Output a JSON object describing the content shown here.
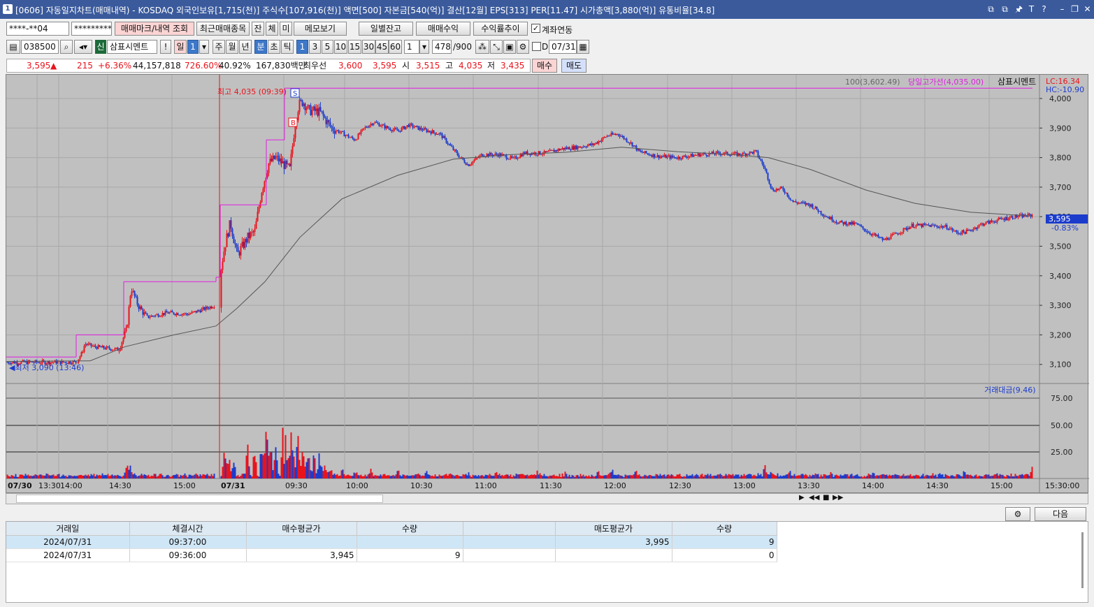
{
  "window": {
    "screen_no": "1",
    "title": "[0606] 자동일지차트(매매내역) - KOSDAQ 외국인보유[1,715(천)] 주식수[107,916(천)] 액면[500] 자본금[540(억)] 결산[12월] EPS[313] PER[11.47] 시가총액[3,880(억)] 유통비율[34.8]",
    "controls": [
      "⧉",
      "⧉",
      "🖈",
      "T",
      "?",
      "–",
      "❐",
      "✕"
    ]
  },
  "toolbar1": {
    "account": "****-**04",
    "password": "*********",
    "mark_query": "매매마크/내역 조회",
    "recent_items": "최근매매종목",
    "tab_jan": "잔",
    "tab_che": "체",
    "tab_mi": "미",
    "memo": "메모보기",
    "daily_balance": "일별잔고",
    "trade_profit": "매매수익",
    "return_trend": "수익률추이",
    "link_account": "계좌연동"
  },
  "toolbar2": {
    "code": "038500",
    "new_badge": "신",
    "name": "삼표시멘트",
    "excl": "!",
    "period_day": "일",
    "period_val": "1",
    "week": "주",
    "month": "월",
    "year": "년",
    "minute": "분",
    "second": "초",
    "tick": "틱",
    "intervals": [
      "1",
      "3",
      "5",
      "10",
      "15",
      "30",
      "45",
      "60"
    ],
    "interval_sel": "1",
    "count": "478",
    "total": "/900",
    "d_label": "D",
    "date": "07/31"
  },
  "quote": {
    "price": "3,595",
    "arrow": "▲",
    "change": "215",
    "change_pct": "+6.36%",
    "volume": "44,157,818",
    "vol_ratio": "726.60%",
    "turnover_pct": "40.92%",
    "amount": "167,830백만",
    "best_label": "최우선",
    "best_ask": "3,600",
    "best_bid": "3,595",
    "open_label": "시",
    "open": "3,515",
    "high_label": "고",
    "high": "4,035",
    "low_label": "저",
    "low": "3,435",
    "buy_btn": "매수",
    "sell_btn": "매도"
  },
  "chart": {
    "legend_ma": "100(3,602.49)",
    "legend_high_line": "당일고가선(4,035.00)",
    "legend_name": "삼표시멘트",
    "lc": "LC:16.34",
    "hc": "HC:-10.90",
    "high_annot": "최고 4,035 (09:39)",
    "low_annot": "◀최저 3,090 (13:46)",
    "current_price_tag": "3,595",
    "current_pct_tag": "-0.83%",
    "vol_legend": "거래대금(9.46)",
    "colors": {
      "up": "#e8141c",
      "down": "#1c3ccc",
      "ma": "#555555",
      "highline": "#e01ee0",
      "vline": "#e8141c"
    }
  },
  "chart_data": {
    "type": "candlestick",
    "y_ticks": [
      "4,000",
      "3,900",
      "3,800",
      "3,700",
      "3,600",
      "3,500",
      "3,400",
      "3,300",
      "3,200",
      "3,100"
    ],
    "vol_ticks": [
      "75.00",
      "50.00",
      "25.00"
    ],
    "x_labels": [
      "07/30",
      "13:30",
      "14:00",
      "14:30",
      "15:00",
      "07/31",
      "09:30",
      "10:00",
      "10:30",
      "11:00",
      "11:30",
      "12:00",
      "12:30",
      "13:00",
      "13:30",
      "14:00",
      "14:30",
      "15:00",
      "15:30:00"
    ],
    "price_path": [
      [
        0,
        3107
      ],
      [
        100,
        3108
      ],
      [
        108,
        3140
      ],
      [
        112,
        3170
      ],
      [
        125,
        3160
      ],
      [
        160,
        3150
      ],
      [
        172,
        3220
      ],
      [
        178,
        3360
      ],
      [
        188,
        3300
      ],
      [
        200,
        3260
      ],
      [
        230,
        3275
      ],
      [
        260,
        3270
      ],
      [
        298,
        3300
      ],
      [
        312,
        3500
      ],
      [
        320,
        3580
      ],
      [
        330,
        3470
      ],
      [
        345,
        3530
      ],
      [
        355,
        3550
      ],
      [
        365,
        3690
      ],
      [
        375,
        3780
      ],
      [
        385,
        3800
      ],
      [
        395,
        3780
      ],
      [
        405,
        3760
      ],
      [
        413,
        3920
      ],
      [
        418,
        3980
      ],
      [
        424,
        3990
      ],
      [
        432,
        3960
      ],
      [
        448,
        3955
      ],
      [
        465,
        3900
      ],
      [
        482,
        3880
      ],
      [
        498,
        3860
      ],
      [
        512,
        3900
      ],
      [
        525,
        3920
      ],
      [
        545,
        3900
      ],
      [
        560,
        3890
      ],
      [
        575,
        3910
      ],
      [
        595,
        3895
      ],
      [
        620,
        3880
      ],
      [
        645,
        3810
      ],
      [
        660,
        3775
      ],
      [
        680,
        3810
      ],
      [
        705,
        3810
      ],
      [
        725,
        3795
      ],
      [
        740,
        3815
      ],
      [
        770,
        3815
      ],
      [
        795,
        3830
      ],
      [
        815,
        3835
      ],
      [
        840,
        3845
      ],
      [
        860,
        3875
      ],
      [
        875,
        3880
      ],
      [
        895,
        3845
      ],
      [
        905,
        3820
      ],
      [
        930,
        3805
      ],
      [
        960,
        3800
      ],
      [
        990,
        3810
      ],
      [
        1020,
        3815
      ],
      [
        1050,
        3810
      ],
      [
        1072,
        3820
      ],
      [
        1085,
        3760
      ],
      [
        1095,
        3690
      ],
      [
        1110,
        3695
      ],
      [
        1125,
        3650
      ],
      [
        1150,
        3640
      ],
      [
        1170,
        3605
      ],
      [
        1190,
        3580
      ],
      [
        1215,
        3575
      ],
      [
        1235,
        3545
      ],
      [
        1255,
        3520
      ],
      [
        1275,
        3545
      ],
      [
        1295,
        3570
      ],
      [
        1320,
        3570
      ],
      [
        1345,
        3565
      ],
      [
        1360,
        3545
      ],
      [
        1375,
        3550
      ],
      [
        1395,
        3575
      ],
      [
        1420,
        3590
      ],
      [
        1440,
        3600
      ],
      [
        1468,
        3605
      ]
    ],
    "ma_path": [
      [
        0,
        3110
      ],
      [
        120,
        3112
      ],
      [
        170,
        3160
      ],
      [
        240,
        3200
      ],
      [
        300,
        3230
      ],
      [
        330,
        3290
      ],
      [
        370,
        3380
      ],
      [
        420,
        3530
      ],
      [
        480,
        3660
      ],
      [
        560,
        3740
      ],
      [
        640,
        3795
      ],
      [
        720,
        3810
      ],
      [
        800,
        3818
      ],
      [
        880,
        3835
      ],
      [
        960,
        3820
      ],
      [
        1040,
        3810
      ],
      [
        1090,
        3800
      ],
      [
        1150,
        3760
      ],
      [
        1230,
        3690
      ],
      [
        1300,
        3645
      ],
      [
        1380,
        3615
      ],
      [
        1468,
        3602
      ]
    ],
    "volume_peaks": [
      [
        172,
        12
      ],
      [
        178,
        9
      ],
      [
        312,
        22
      ],
      [
        318,
        14
      ],
      [
        325,
        18
      ],
      [
        345,
        25
      ],
      [
        355,
        31
      ],
      [
        365,
        40
      ],
      [
        372,
        46
      ],
      [
        378,
        30
      ],
      [
        385,
        22
      ],
      [
        395,
        36
      ],
      [
        400,
        42
      ],
      [
        408,
        44
      ],
      [
        416,
        39
      ],
      [
        424,
        32
      ],
      [
        432,
        26
      ],
      [
        440,
        18
      ],
      [
        448,
        22
      ],
      [
        456,
        12
      ],
      [
        464,
        10
      ],
      [
        480,
        8
      ],
      [
        500,
        7
      ],
      [
        520,
        8
      ],
      [
        560,
        6
      ],
      [
        600,
        5
      ],
      [
        660,
        4
      ],
      [
        700,
        5
      ],
      [
        760,
        5
      ],
      [
        800,
        4
      ],
      [
        845,
        6
      ],
      [
        866,
        7
      ],
      [
        900,
        5
      ],
      [
        960,
        4
      ],
      [
        1085,
        9
      ],
      [
        1095,
        6
      ],
      [
        1120,
        7
      ],
      [
        1180,
        4
      ],
      [
        1240,
        5
      ],
      [
        1300,
        4
      ],
      [
        1370,
        5
      ],
      [
        1420,
        4
      ],
      [
        1468,
        9
      ]
    ]
  },
  "scroll_icons": [
    "▶",
    "◀◀",
    "■",
    "▶▶"
  ],
  "table": {
    "headers": [
      "거래일",
      "체결시간",
      "매수평균가",
      "수량",
      "",
      "매도평균가",
      "수량"
    ],
    "rows": [
      [
        "2024/07/31",
        "09:37:00",
        "",
        "",
        "",
        "3,995",
        "9"
      ],
      [
        "2024/07/31",
        "09:36:00",
        "3,945",
        "9",
        "",
        "",
        "0"
      ]
    ],
    "next_btn": "다음"
  }
}
